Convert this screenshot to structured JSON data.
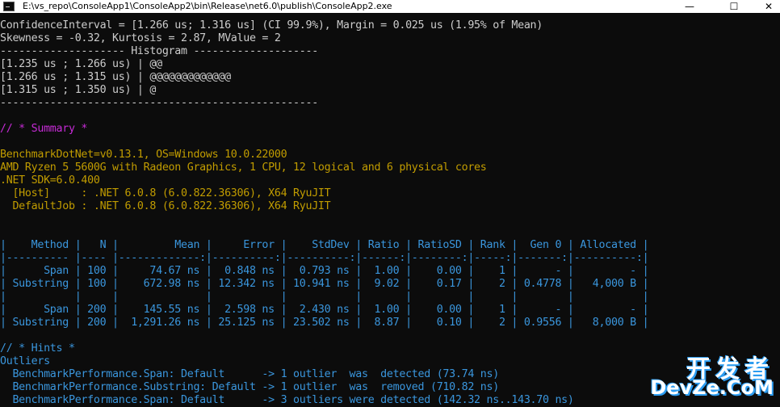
{
  "window": {
    "title": "E:\\vs_repo\\ConsoleApp1\\ConsoleApp2\\bin\\Release\\net6.0\\publish\\ConsoleApp2.exe",
    "minimize": "—",
    "maximize": "☐",
    "close": "✕"
  },
  "colors": {
    "text": "#cccccc",
    "yellow": "#c19c00",
    "teal": "#3a96dd",
    "magenta": "#881798",
    "bg": "#0c0c0c"
  },
  "lines": [
    {
      "text": "ConfidenceInterval = [1.266 us; 1.316 us] (CI 99.9%), Margin = 0.025 us (1.95% of Mean)",
      "color": "#cccccc"
    },
    {
      "text": "Skewness = -0.32, Kurtosis = 2.87, MValue = 2",
      "color": "#cccccc"
    },
    {
      "text": "-------------------- Histogram --------------------",
      "color": "#cccccc"
    },
    {
      "text": "[1.235 us ; 1.266 us) | @@",
      "color": "#cccccc"
    },
    {
      "text": "[1.266 us ; 1.315 us) | @@@@@@@@@@@@@",
      "color": "#cccccc"
    },
    {
      "text": "[1.315 us ; 1.350 us) | @",
      "color": "#cccccc"
    },
    {
      "text": "---------------------------------------------------",
      "color": "#cccccc"
    },
    {
      "text": "",
      "color": "#cccccc"
    },
    {
      "text": "// * Summary *",
      "color": "#c62bd6"
    },
    {
      "text": "",
      "color": "#cccccc"
    },
    {
      "text": "BenchmarkDotNet=v0.13.1, OS=Windows 10.0.22000",
      "color": "#c19c00"
    },
    {
      "text": "AMD Ryzen 5 5600G with Radeon Graphics, 1 CPU, 12 logical and 6 physical cores",
      "color": "#c19c00"
    },
    {
      "text": ".NET SDK=6.0.400",
      "color": "#c19c00"
    },
    {
      "text": "  [Host]     : .NET 6.0.8 (6.0.822.36306), X64 RyuJIT",
      "color": "#c19c00"
    },
    {
      "text": "  DefaultJob : .NET 6.0.8 (6.0.822.36306), X64 RyuJIT",
      "color": "#c19c00"
    },
    {
      "text": "",
      "color": "#cccccc"
    },
    {
      "text": "",
      "color": "#cccccc"
    },
    {
      "text": "|    Method |   N |         Mean |     Error |    StdDev | Ratio | RatioSD | Rank |  Gen 0 | Allocated |",
      "color": "#3a96dd"
    },
    {
      "text": "|---------- |---- |-------------:|----------:|----------:|------:|--------:|-----:|-------:|----------:|",
      "color": "#3a96dd"
    },
    {
      "text": "|      Span | 100 |     74.67 ns |  0.848 ns |  0.793 ns |  1.00 |    0.00 |    1 |      - |         - |",
      "color": "#3a96dd"
    },
    {
      "text": "| Substring | 100 |    672.98 ns | 12.342 ns | 10.941 ns |  9.02 |    0.17 |    2 | 0.4778 |   4,000 B |",
      "color": "#3a96dd"
    },
    {
      "text": "|           |     |              |           |           |       |         |      |        |           |",
      "color": "#3a96dd"
    },
    {
      "text": "|      Span | 200 |    145.55 ns |  2.598 ns |  2.430 ns |  1.00 |    0.00 |    1 |      - |         - |",
      "color": "#3a96dd"
    },
    {
      "text": "| Substring | 200 |  1,291.26 ns | 25.125 ns | 23.502 ns |  8.87 |    0.10 |    2 | 0.9556 |   8,000 B |",
      "color": "#3a96dd"
    },
    {
      "text": "",
      "color": "#cccccc"
    },
    {
      "text": "// * Hints *",
      "color": "#3a96dd"
    },
    {
      "text": "Outliers",
      "color": "#3a96dd"
    },
    {
      "text": "  BenchmarkPerformance.Span: Default      -> 1 outlier  was  detected (73.74 ns)",
      "color": "#3a96dd"
    },
    {
      "text": "  BenchmarkPerformance.Substring: Default -> 1 outlier  was  removed (710.82 ns)",
      "color": "#3a96dd"
    },
    {
      "text": "  BenchmarkPerformance.Span: Default      -> 3 outliers were detected (142.32 ns..143.70 ns)",
      "color": "#3a96dd"
    }
  ],
  "watermark": {
    "cn": "开发者",
    "en": "DevZe.CoM"
  }
}
